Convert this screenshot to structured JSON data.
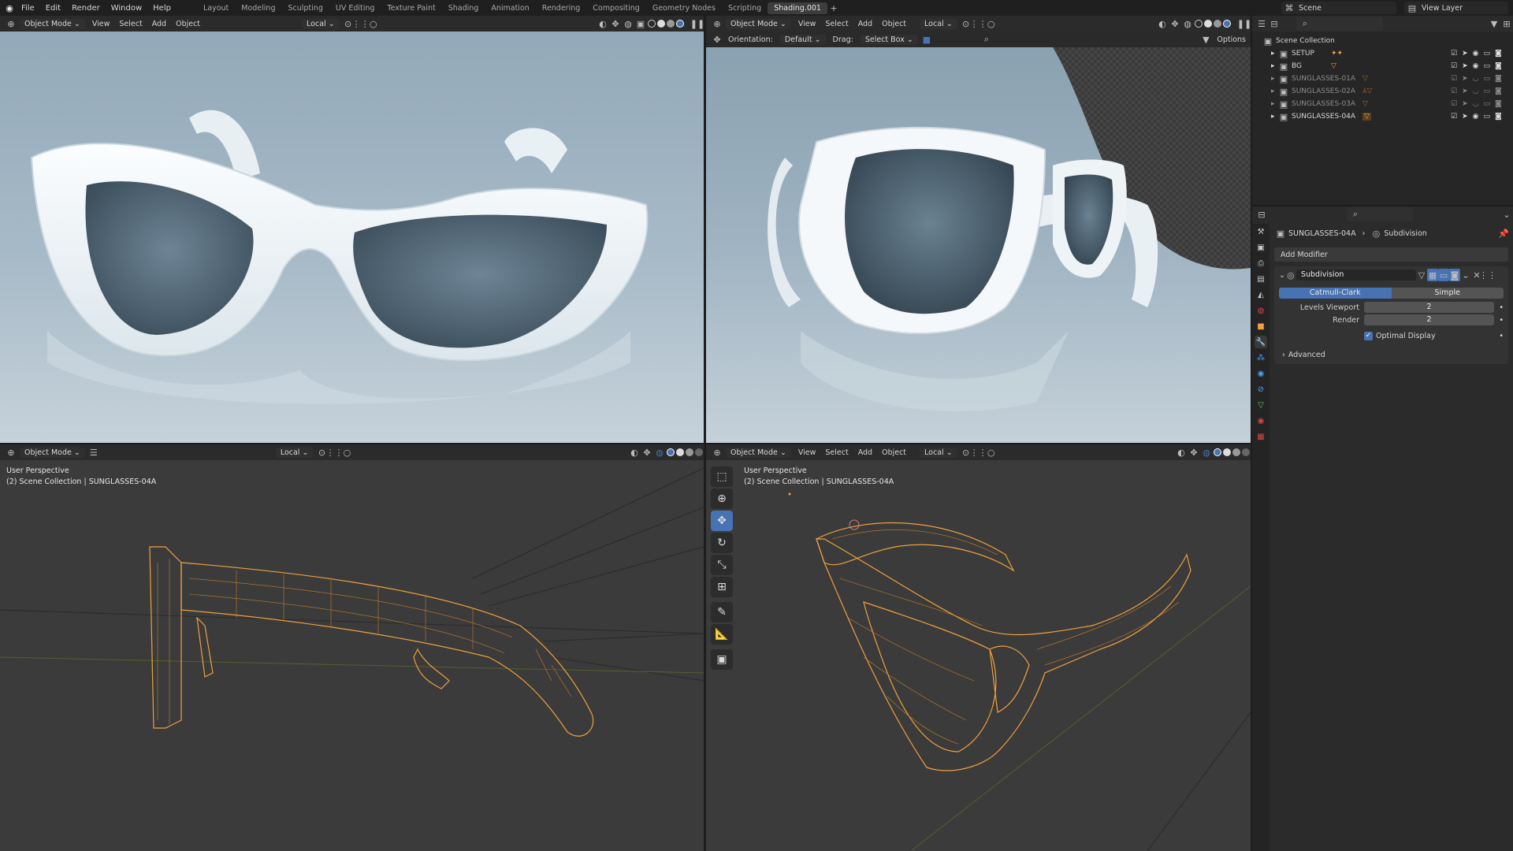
{
  "topbar": {
    "menus": [
      "File",
      "Edit",
      "Render",
      "Window",
      "Help"
    ],
    "workspaces": [
      "Layout",
      "Modeling",
      "Sculpting",
      "UV Editing",
      "Texture Paint",
      "Shading",
      "Animation",
      "Rendering",
      "Compositing",
      "Geometry Nodes",
      "Scripting",
      "Shading.001"
    ],
    "active_workspace": "Shading.001",
    "scene_name": "Scene",
    "view_layer": "View Layer"
  },
  "viewport_header": {
    "mode": "Object Mode",
    "menus": [
      "View",
      "Select",
      "Add",
      "Object"
    ],
    "pivot": "Local"
  },
  "tool_settings": {
    "orientation_label": "Orientation:",
    "orientation_value": "Default",
    "drag_label": "Drag:",
    "drag_value": "Select Box",
    "options": "Options"
  },
  "wire_views": {
    "perspective_label": "User Perspective",
    "collection_line": "(2) Scene Collection | SUNGLASSES-04A"
  },
  "outliner": {
    "root": "Scene Collection",
    "items": [
      {
        "name": "SETUP",
        "muted": false
      },
      {
        "name": "BG",
        "muted": false
      },
      {
        "name": "SUNGLASSES-01A",
        "muted": true
      },
      {
        "name": "SUNGLASSES-02A",
        "muted": true
      },
      {
        "name": "SUNGLASSES-03A",
        "muted": true
      },
      {
        "name": "SUNGLASSES-04A",
        "muted": false
      }
    ]
  },
  "properties": {
    "object_name": "SUNGLASSES-04A",
    "modifier_breadcrumb": "Subdivision",
    "add_modifier": "Add Modifier",
    "modifier_name": "Subdivision",
    "method_catmull": "Catmull-Clark",
    "method_simple": "Simple",
    "levels_viewport_label": "Levels Viewport",
    "levels_viewport": "2",
    "render_label": "Render",
    "render_levels": "2",
    "optimal_display": "Optimal Display",
    "advanced": "Advanced"
  },
  "colors": {
    "accent": "#4772b3",
    "selection_orange": "#f0a03c",
    "wire_bg": "#3d3d3d"
  }
}
